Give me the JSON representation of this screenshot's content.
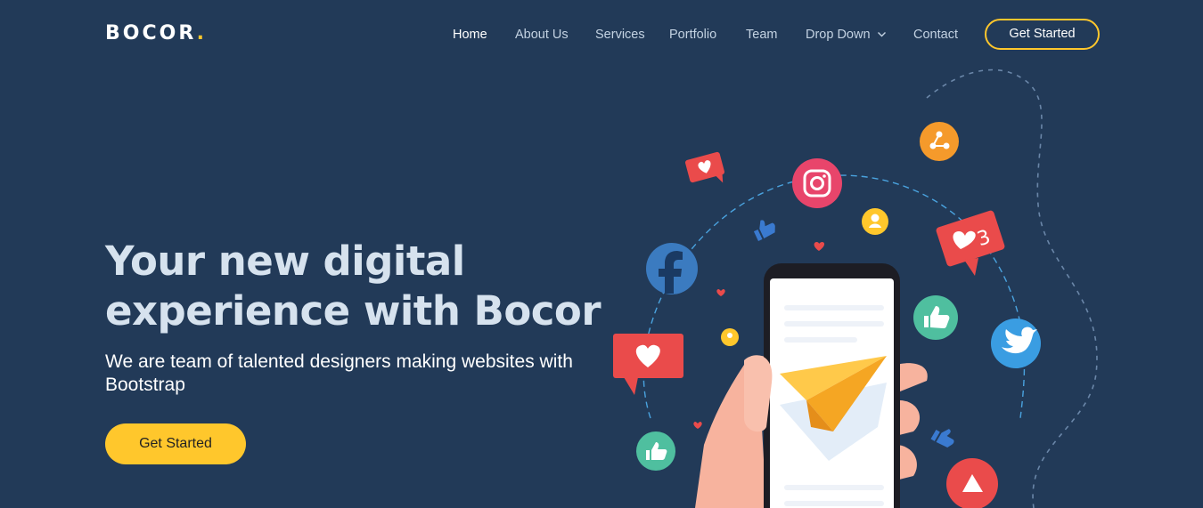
{
  "header": {
    "logo_text": "BOCOR",
    "logo_dot": ".",
    "nav": [
      {
        "label": "Home",
        "active": true
      },
      {
        "label": "About Us",
        "active": false
      },
      {
        "label": "Services",
        "active": false
      },
      {
        "label": "Portfolio",
        "active": false
      },
      {
        "label": "Team",
        "active": false
      },
      {
        "label": "Drop Down",
        "active": false,
        "has_dropdown": true
      },
      {
        "label": "Contact",
        "active": false
      }
    ],
    "cta_label": "Get Started"
  },
  "hero": {
    "title_line1": "Your new digital",
    "title_line2": "experience with Bocor",
    "subtitle": "We are team of talented designers making websites with Bootstrap",
    "cta_label": "Get Started"
  },
  "illustration": {
    "notification_count": "3",
    "icons": [
      "facebook-icon",
      "instagram-icon",
      "twitter-icon",
      "share-icon",
      "user-icon",
      "like-icon",
      "heart-icon",
      "youtube-icon",
      "paper-plane-icon"
    ]
  },
  "colors": {
    "background": "#223a58",
    "accent": "#ffc72c",
    "facebook": "#3b7bc0",
    "instagram": "#e8456b",
    "twitter": "#3a9de2",
    "like_green": "#4fbf9f",
    "heart_red": "#ea4b4b",
    "orange": "#f59a2b"
  }
}
